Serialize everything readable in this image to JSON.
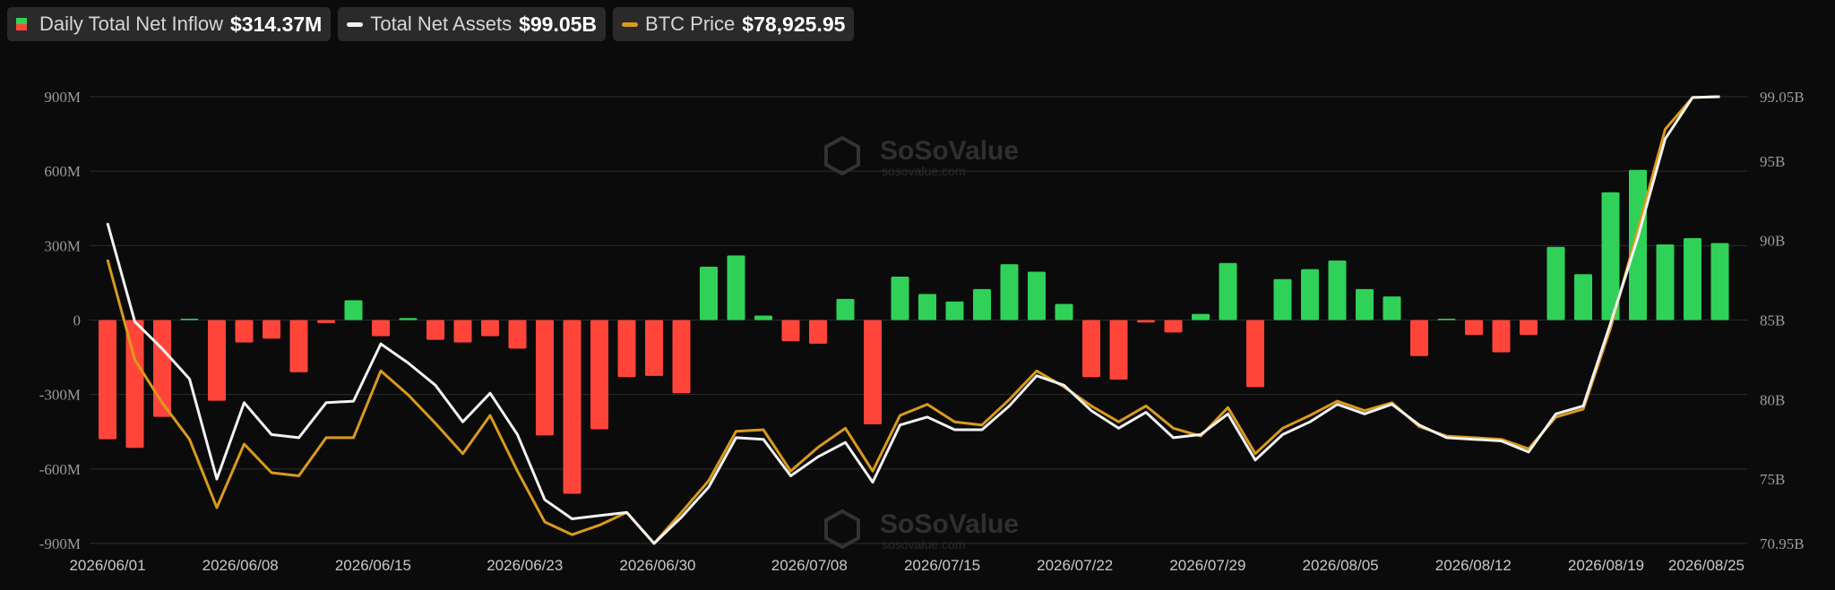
{
  "legend": {
    "inflow": {
      "label": "Daily Total Net Inflow",
      "value": "$314.37M"
    },
    "assets": {
      "label": "Total Net Assets",
      "value": "$99.05B"
    },
    "btc": {
      "label": "BTC Price",
      "value": "$78,925.95"
    }
  },
  "watermark": {
    "name": "SoSoValue",
    "url": "sosovalue.com"
  },
  "colors": {
    "positive": "#30d158",
    "negative": "#ff453a",
    "assets_line": "#f2f2f2",
    "btc_line": "#d99a1e",
    "grid": "#2c2c2c"
  },
  "chart_data": {
    "type": "bar",
    "x_start_date": "2026/06/01",
    "x_tick_labels": [
      "2026/06/01",
      "2026/06/08",
      "2026/06/15",
      "2026/06/23",
      "2026/06/30",
      "2026/07/08",
      "2026/07/15",
      "2026/07/22",
      "2026/07/29",
      "2026/08/05",
      "2026/08/12",
      "2026/08/19",
      "2026/08/25"
    ],
    "y_left": {
      "ticks": [
        -900,
        -600,
        -300,
        0,
        300,
        600,
        900
      ],
      "tick_labels": [
        "-900M",
        "-600M",
        "-300M",
        "0",
        "300M",
        "600M",
        "900M"
      ],
      "range": [
        -900,
        900
      ]
    },
    "y_right": {
      "ticks": [
        70.95,
        75,
        80,
        85,
        90,
        95,
        99.05
      ],
      "tick_labels": [
        "70.95B",
        "75B",
        "80B",
        "85B",
        "90B",
        "95B",
        "99.05B"
      ],
      "range": [
        70.95,
        99.05
      ]
    },
    "grid": true,
    "series": [
      {
        "name": "Daily Total Net Inflow",
        "unit": "M USD",
        "values": [
          -480,
          -515,
          -390,
          3,
          -325,
          -90,
          -75,
          -210,
          -12,
          80,
          -65,
          8,
          -80,
          -90,
          -65,
          -115,
          -465,
          -700,
          -440,
          -230,
          -225,
          -295,
          215,
          260,
          18,
          -85,
          -95,
          85,
          -420,
          175,
          105,
          75,
          125,
          225,
          195,
          65,
          -230,
          -240,
          -10,
          -50,
          25,
          230,
          -270,
          165,
          205,
          240,
          125,
          95,
          -145,
          3,
          -60,
          -130,
          -60,
          295,
          185,
          515,
          605,
          305,
          330,
          310
        ]
      },
      {
        "name": "Total Net Assets",
        "unit": "B USD",
        "values": [
          91.1,
          84.9,
          83.2,
          81.3,
          75.0,
          79.8,
          77.8,
          77.6,
          79.8,
          79.9,
          83.5,
          82.3,
          80.9,
          78.6,
          80.4,
          77.8,
          73.7,
          72.5,
          72.7,
          72.9,
          70.95,
          72.6,
          74.5,
          77.6,
          77.5,
          75.2,
          76.4,
          77.3,
          74.8,
          78.4,
          78.9,
          78.1,
          78.1,
          79.6,
          81.5,
          80.9,
          79.3,
          78.2,
          79.2,
          77.6,
          77.8,
          79.1,
          76.2,
          77.8,
          78.6,
          79.7,
          79.1,
          79.7,
          78.4,
          77.6,
          77.5,
          77.4,
          76.7,
          79.1,
          79.6,
          84.8,
          90.2,
          96.4,
          99.0,
          99.05
        ]
      },
      {
        "name": "BTC Price",
        "unit": "B USD scale",
        "values": [
          88.8,
          82.5,
          79.8,
          77.5,
          73.2,
          77.2,
          75.4,
          75.2,
          77.6,
          77.6,
          81.8,
          80.3,
          78.5,
          76.6,
          79.0,
          75.5,
          72.3,
          71.5,
          72.1,
          72.9,
          70.95,
          72.9,
          74.9,
          78.0,
          78.1,
          75.5,
          77.0,
          78.2,
          75.5,
          79.0,
          79.7,
          78.6,
          78.4,
          80.0,
          81.8,
          80.8,
          79.6,
          78.6,
          79.6,
          78.2,
          77.7,
          79.5,
          76.6,
          78.2,
          79.0,
          79.9,
          79.3,
          79.8,
          78.3,
          77.7,
          77.6,
          77.5,
          76.9,
          78.9,
          79.4,
          84.5,
          90.7,
          97.0,
          99.0,
          99.05
        ]
      }
    ]
  }
}
